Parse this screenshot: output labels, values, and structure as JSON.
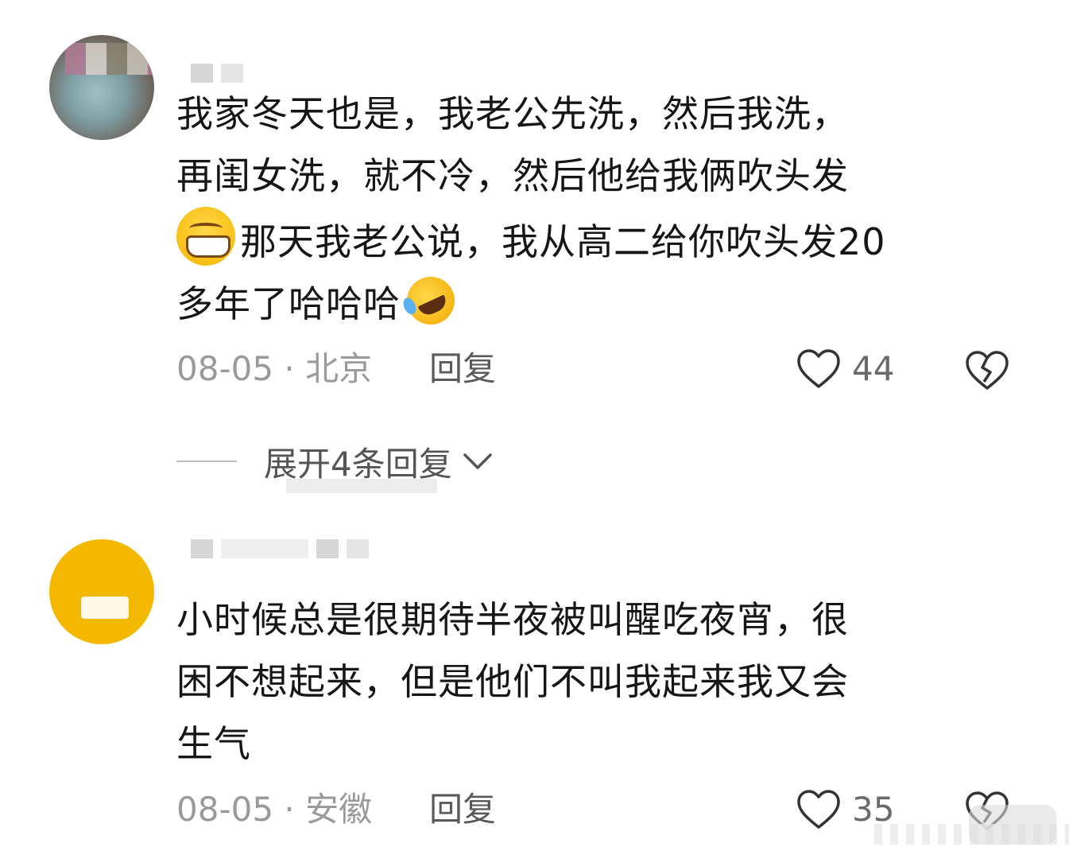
{
  "comments": [
    {
      "text_part1": "我家冬天也是，我老公先洗，然后我洗，\n再闺女洗，就不冷，然后他给我俩吹头发\n",
      "text_part2": "那天我老公说，我从高二给你吹头发20\n多年了哈哈哈",
      "emojis": [
        "grinning-face-emoji",
        "rofl-emoji"
      ],
      "date": "08-05 · 北京",
      "reply_label": "回复",
      "like_count": "44"
    },
    {
      "text": "小时候总是很期待半夜被叫醒吃夜宵，很\n困不想起来，但是他们不叫我起来我又会\n生气",
      "date": "08-05 · 安徽",
      "reply_label": "回复",
      "like_count": "35"
    }
  ],
  "expand_replies": {
    "label": "展开4条回复"
  },
  "colors": {
    "text": "#161616",
    "meta": "#9a9a9a",
    "reply": "#5a5a5a",
    "avatar2": "#f5b800"
  },
  "icons": [
    "heart-outline-icon",
    "broken-heart-icon",
    "chevron-down-icon"
  ]
}
